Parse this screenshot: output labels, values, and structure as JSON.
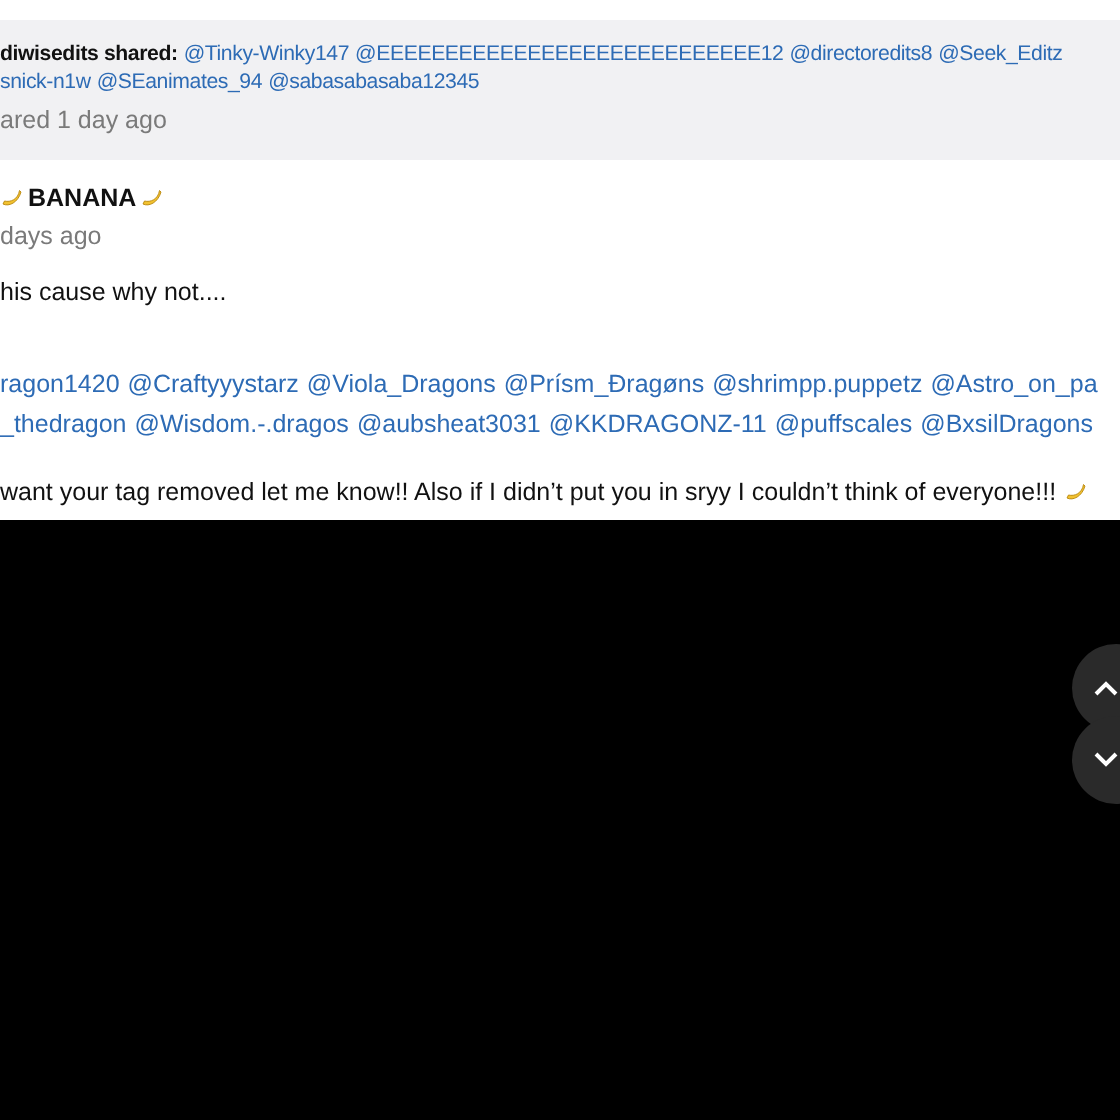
{
  "share": {
    "author": "diwisedits shared:",
    "mention_lines": [
      [
        "@Tinky-Winky147",
        "@EEEEEEEEEEEEEEEEEEEEEEEEEEEE12",
        "@directoredits8",
        "@Seek_Editz"
      ],
      [
        "snick-n1w",
        "@SEanimates_94",
        "@sabasabasaba12345"
      ]
    ],
    "time": "ared 1 day ago"
  },
  "post": {
    "author": "BANANA",
    "time": "days ago",
    "intro": "his cause why not....",
    "mention_lines": [
      [
        "ragon1420",
        "@Craftyyystarz",
        "@Viola_Dragons",
        "@Prísm_Đragøns",
        "@shrimpp.puppetz",
        "@Astro_on_pa"
      ],
      [
        "_thedragon",
        "@Wisdom.-.dragos",
        "@aubsheat3031",
        "@KKDRAGONZ-11",
        "@puffscales",
        "@BxsilDragons"
      ]
    ],
    "closing": "want your tag removed let me know!! Also if I didn’t put you in sryy I couldn’t think of everyone!!!"
  }
}
